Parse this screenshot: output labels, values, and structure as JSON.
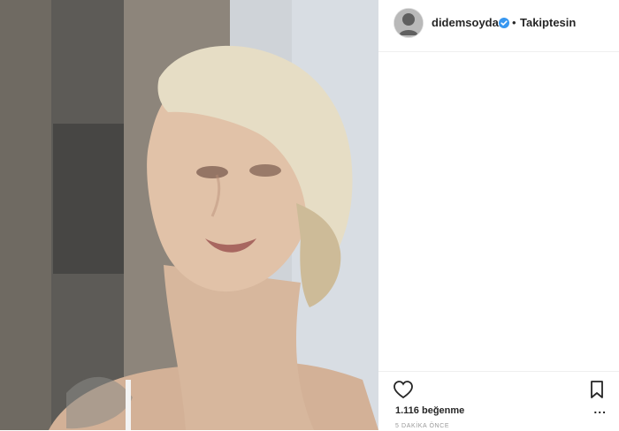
{
  "post": {
    "username": "didemsoydan",
    "separator": "•",
    "follow_state": "Takiptesin",
    "likes": "1.116 beğenme",
    "timestamp": "5 DAKİKA ÖNCE",
    "more_label": "..."
  },
  "icons": {
    "verified": "verified-badge-icon",
    "like": "heart-icon",
    "save": "bookmark-icon",
    "more": "more-options-icon"
  },
  "colors": {
    "text": "#262626",
    "muted": "#999999",
    "verified": "#3897f0",
    "divider": "#efefef"
  }
}
